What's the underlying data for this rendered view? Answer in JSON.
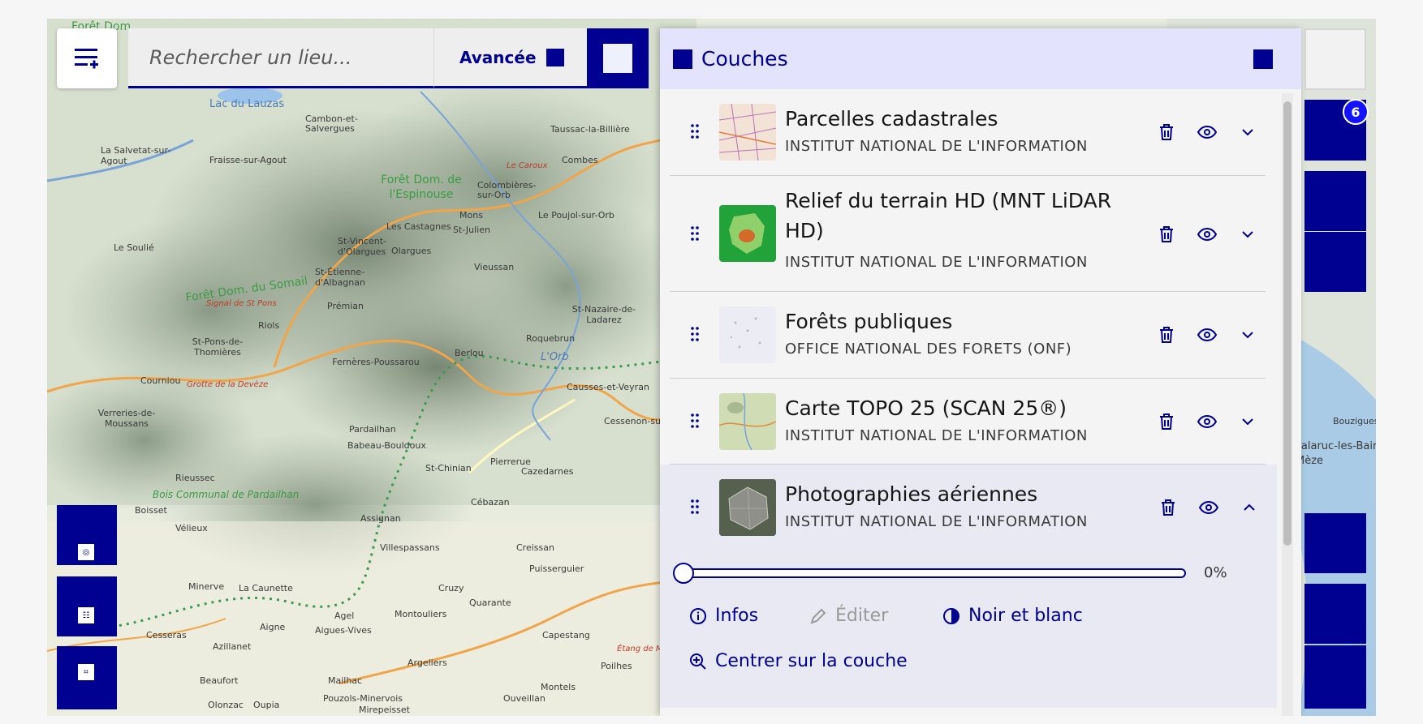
{
  "search": {
    "placeholder": "Rechercher un lieu...",
    "advanced_label": "Avancée"
  },
  "map_labels": [
    "Forêt Dom.",
    "Lac du Lauzas",
    "Cambon-et-Salvergues",
    "La Salvetat-sur-Agout",
    "Fraisse-sur-Agout",
    "Forêt Dom. de l'Espinouse",
    "Colombières-sur-Orb",
    "Le Poujol-sur-Orb",
    "Le Soulié",
    "Olargues",
    "Forêt Dom. du Somail",
    "Signal de St Pons",
    "St-Pons-de-Thomières",
    "Riols",
    "Prémian",
    "Fernères-Poussarou",
    "Berlou",
    "Roquebrun",
    "L'Orb",
    "Courniou",
    "Grotte de la Devèze",
    "Verreries-de-Moussans",
    "Pardailhan",
    "Babeau-Bouldoux",
    "St-Chinian",
    "Pierrerue",
    "Cazedarnes",
    "Rieussec",
    "Bois Communal de Pardailhan",
    "Cébazan",
    "Assignan",
    "Boisset",
    "Vélieux",
    "Villespassans",
    "Creissan",
    "Puisserguier",
    "Minerve",
    "La Caunette",
    "Cruzy",
    "Quarante",
    "Agel",
    "Aigne",
    "Aigues-Vives",
    "Cesseras",
    "Azillanet",
    "Montouliers",
    "Capestang",
    "Beaufort",
    "Mailhac",
    "Argeliers",
    "Olonzac",
    "Oupia",
    "Pouzols-Minervois",
    "Mirepeisset",
    "Ouveillan",
    "Montels",
    "Poilhes",
    "Étang de Montady",
    "Cessenon-sur-Orb",
    "Causses-et-Veyran",
    "St-Nazaire-de-Ladarez",
    "Vieussan",
    "Mons",
    "St-Julien",
    "Les Castagnes",
    "St-Vincent-d'Olargues",
    "St-Étienne-d'Albagnan",
    "Taussac-la-Billière",
    "Combes",
    "Le Caroux",
    "Bouzigues",
    "Balaruc-les-Bains",
    "Mèze"
  ],
  "panel": {
    "title": "Couches",
    "layers": [
      {
        "title": "Parcelles cadastrales",
        "source": "INSTITUT NATIONAL DE L'INFORMATION"
      },
      {
        "title_line1": "Relief du terrain HD (MNT LiDAR",
        "title_line2": "HD)",
        "source": "INSTITUT NATIONAL DE L'INFORMATION"
      },
      {
        "title": "Forêts publiques",
        "source": "OFFICE NATIONAL DES FORETS (ONF)"
      },
      {
        "title": "Carte TOPO 25 (SCAN 25®)",
        "source": "INSTITUT NATIONAL DE L'INFORMATION"
      },
      {
        "title": "Photographies aériennes",
        "source": "INSTITUT NATIONAL DE L'INFORMATION"
      }
    ],
    "opacity_percent": "0%",
    "options": {
      "infos": "Infos",
      "edit": "Éditer",
      "bw": "Noir et blanc",
      "center": "Centrer sur la couche"
    }
  },
  "right_toolbar": {
    "badge_count": "6"
  },
  "colors": {
    "accent": "#000091",
    "header_bg": "#e3e3fd",
    "badge": "#1212ff"
  }
}
